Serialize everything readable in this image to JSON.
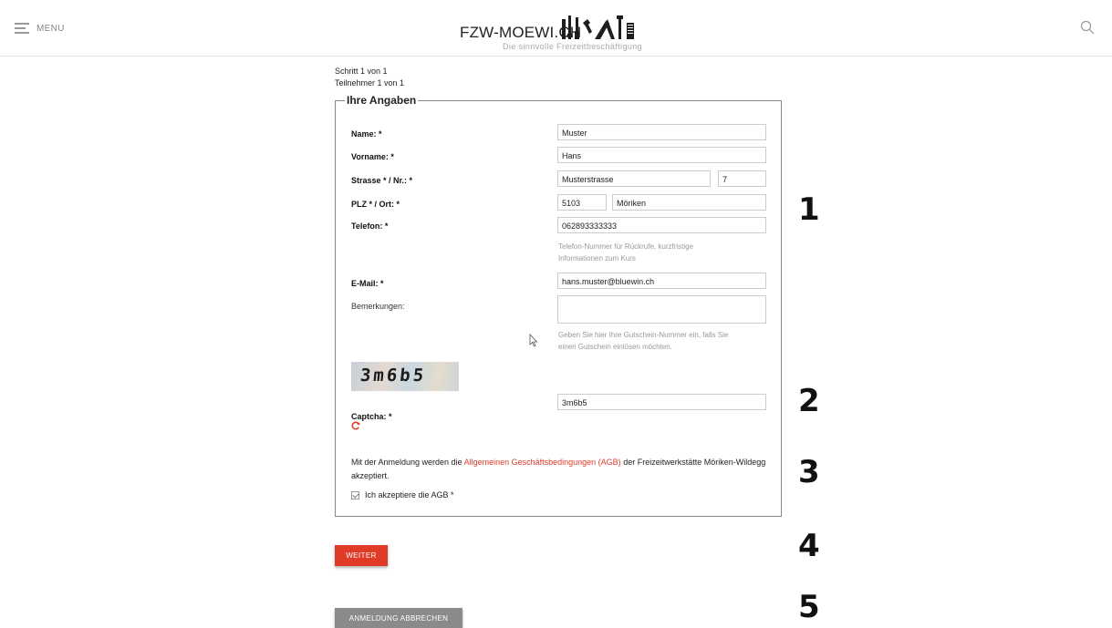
{
  "header": {
    "menu_label": "MENU",
    "logo_text": "FZW-MOEWI.CH",
    "logo_subtitle": "Die sinnvolle Freizeitbeschäftigung"
  },
  "progress": {
    "step": "Schritt 1 von 1",
    "participant": "Teilnehmer 1 von 1"
  },
  "form": {
    "legend": "Ihre Angaben",
    "name": {
      "label": "Name: *",
      "value": "Muster"
    },
    "vorname": {
      "label": "Vorname: *",
      "value": "Hans"
    },
    "strasse": {
      "label": "Strasse * / Nr.: *",
      "street": "Musterstrasse",
      "number": "7"
    },
    "plz_ort": {
      "label": "PLZ * / Ort: *",
      "plz": "5103",
      "ort": "Möriken"
    },
    "telefon": {
      "label": "Telefon: *",
      "value": "062893333333",
      "help_line1": "Telefon-Nummer für Rückrufe, kurzfristige",
      "help_line2": "Informationen zum Kurs"
    },
    "email": {
      "label": "E-Mail: *",
      "value": "hans.muster@bluewin.ch"
    },
    "bemerkungen": {
      "label": "Bemerkungen:",
      "value": "",
      "help_line1": "Geben Sie hier Ihre Gutschein-Nummer ein, falls Sie",
      "help_line2": "einen Gutschein einlösen möchten."
    },
    "captcha": {
      "image_text": "3m6b5",
      "label": "Captcha: *",
      "value": "3m6b5"
    },
    "agb": {
      "text_before": "Mit der Anmeldung werden die ",
      "link": "Allgemeinen Geschäftsbedingungen (AGB)",
      "text_after": " der Freizeitwerkstätte Möriken-Wildegg akzeptiert.",
      "checkbox_label": "Ich akzeptiere die AGB *",
      "checked": true
    }
  },
  "buttons": {
    "weiter": "WEITER",
    "cancel": "ANMELDUNG ABBRECHEN"
  },
  "annotations": [
    "1",
    "2",
    "3",
    "4",
    "5"
  ],
  "colors": {
    "accent": "#e03b26",
    "cancel": "#8a8a8a"
  },
  "icons": [
    "hamburger-icon",
    "search-icon",
    "refresh-icon",
    "checkbox-icon",
    "cursor-icon"
  ]
}
